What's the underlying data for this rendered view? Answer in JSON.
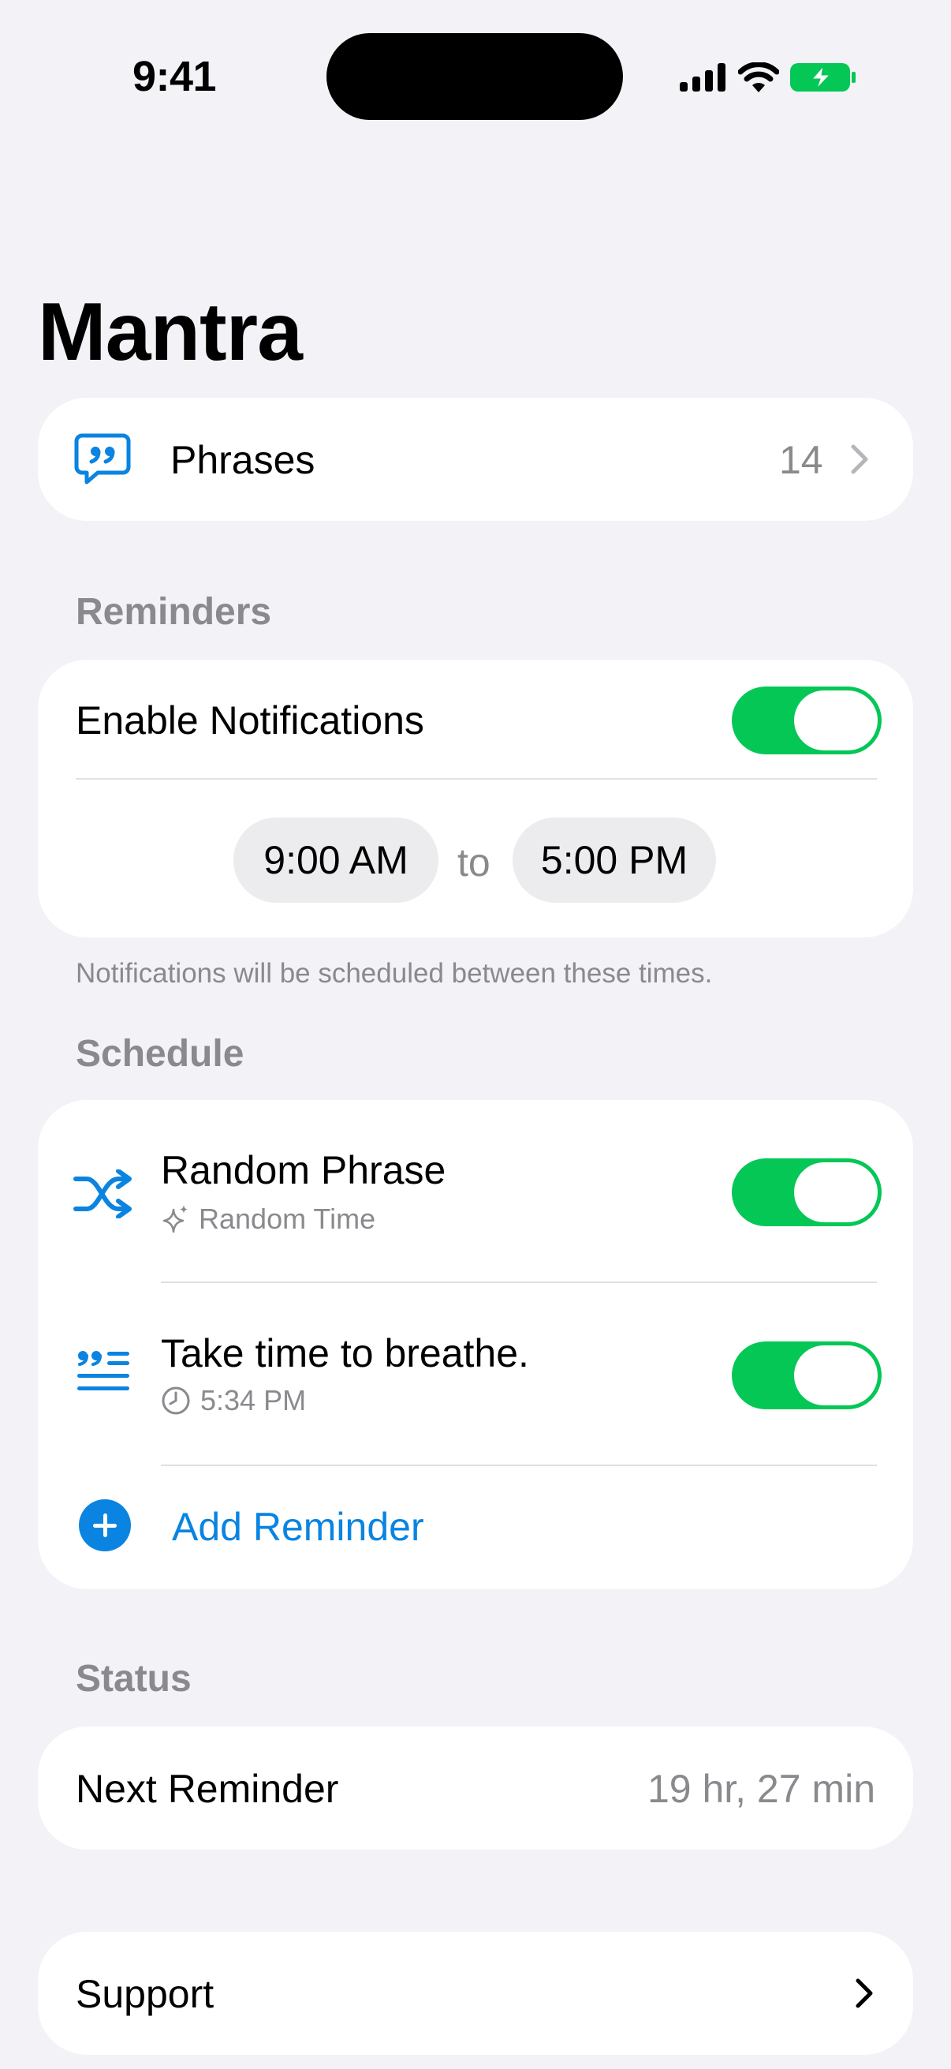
{
  "status_bar": {
    "time": "9:41"
  },
  "app_title": "Mantra",
  "phrases": {
    "label": "Phrases",
    "count": "14"
  },
  "reminders": {
    "section_label": "Reminders",
    "enable_label": "Enable Notifications",
    "enabled": true,
    "start_time": "9:00 AM",
    "to_label": "to",
    "end_time": "5:00 PM",
    "footnote": "Notifications will be scheduled between these times."
  },
  "schedule": {
    "section_label": "Schedule",
    "items": [
      {
        "title": "Random Phrase",
        "subtitle": "Random Time",
        "icon": "shuffle-icon",
        "sub_icon": "sparkles-icon",
        "enabled": true
      },
      {
        "title": "Take time to breathe.",
        "subtitle": "5:34 PM",
        "icon": "quote-lines-icon",
        "sub_icon": "clock-icon",
        "enabled": true
      }
    ],
    "add_label": "Add Reminder"
  },
  "status": {
    "section_label": "Status",
    "next_label": "Next Reminder",
    "next_value": "19 hr, 27 min"
  },
  "support": {
    "label": "Support"
  },
  "colors": {
    "accent": "#0a84e0",
    "toggle_on": "#04c756",
    "background": "#f2f2f7",
    "secondary_text": "#8a8a8e"
  }
}
